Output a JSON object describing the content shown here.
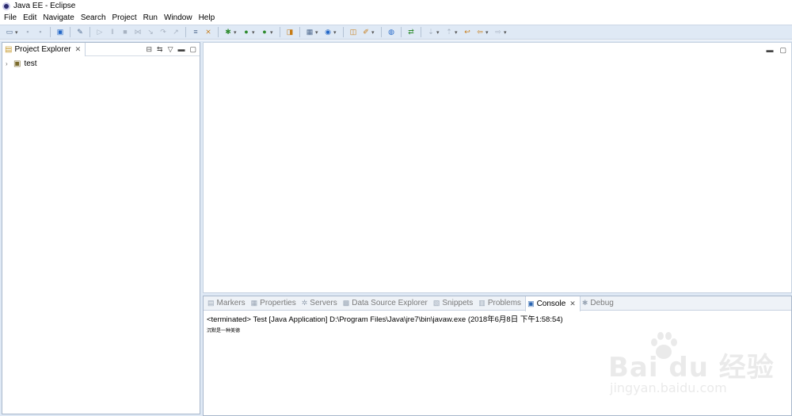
{
  "window": {
    "title": "Java EE - Eclipse"
  },
  "menu": [
    "File",
    "Edit",
    "Navigate",
    "Search",
    "Project",
    "Run",
    "Window",
    "Help"
  ],
  "toolbar": {
    "icons": [
      "new-icon",
      "save-icon",
      "save-all-icon",
      "open-task-icon",
      "pin-icon",
      "resume-icon",
      "suspend-icon",
      "terminate-icon",
      "disconnect-icon",
      "step-into-icon",
      "step-over-icon",
      "step-return-icon",
      "toggle-comment-icon",
      "skip-breakpoints-icon",
      "debug-icon",
      "run-icon",
      "external-tools-icon",
      "new-java-project-icon",
      "new-package-icon",
      "new-class-icon",
      "open-type-icon",
      "search-icon",
      "web-browser-icon",
      "synchronize-icon",
      "next-annotation-icon",
      "previous-annotation-icon",
      "last-edit-icon",
      "back-icon",
      "forward-icon"
    ]
  },
  "project_explorer": {
    "tab_label": "Project Explorer",
    "close_symbol": "✕",
    "items": [
      {
        "label": "test"
      }
    ]
  },
  "console_view": {
    "tabs": [
      {
        "label": "Markers"
      },
      {
        "label": "Properties"
      },
      {
        "label": "Servers"
      },
      {
        "label": "Data Source Explorer"
      },
      {
        "label": "Snippets"
      },
      {
        "label": "Problems"
      },
      {
        "label": "Console",
        "active": true
      },
      {
        "label": "Debug"
      }
    ],
    "description": "<terminated> Test [Java Application] D:\\Program Files\\Java\\jre7\\bin\\javaw.exe (2018年6月8日 下午1:58:54)",
    "output": "沉默是一种美德"
  },
  "watermark": {
    "brand": "Bai du 经验",
    "url": "jingyan.baidu.com"
  },
  "colors": {
    "toolbar_bg": "#dfe9f5",
    "workbench_bg": "#dfe9f5",
    "border": "#a9b8cc",
    "active_icon": "#2a64b0"
  }
}
